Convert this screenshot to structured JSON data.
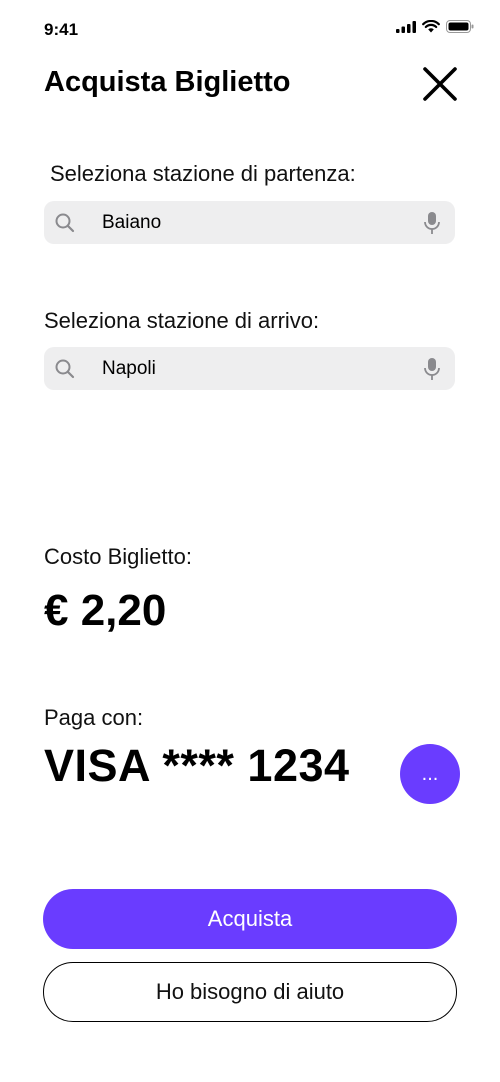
{
  "status_bar": {
    "time": "9:41",
    "icons": [
      "cellular-signal-icon",
      "wifi-icon",
      "battery-icon"
    ]
  },
  "header": {
    "title": "Acquista Biglietto",
    "close_icon": "close-icon"
  },
  "departure": {
    "label": "Seleziona stazione di partenza:",
    "value": "Baiano"
  },
  "arrival": {
    "label": "Seleziona stazione di arrivo:",
    "value": "Napoli"
  },
  "cost": {
    "label": "Costo Biglietto:",
    "value": "€ 2,20"
  },
  "payment": {
    "label": "Paga con:",
    "card": "VISA **** 1234",
    "more_label": "..."
  },
  "actions": {
    "buy_label": "Acquista",
    "help_label": "Ho bisogno di aiuto"
  },
  "colors": {
    "accent": "#6a3cff",
    "field_bg": "#eeeeef"
  }
}
